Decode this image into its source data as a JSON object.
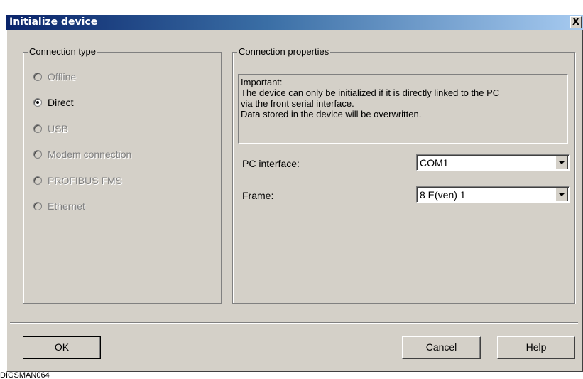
{
  "window": {
    "title": "Initialize device",
    "close_glyph": "X"
  },
  "connection_type": {
    "legend": "Connection type",
    "options": [
      {
        "label": "Offline",
        "enabled": false,
        "selected": false
      },
      {
        "label": "Direct",
        "enabled": true,
        "selected": true
      },
      {
        "label": "USB",
        "enabled": false,
        "selected": false
      },
      {
        "label": "Modem connection",
        "enabled": false,
        "selected": false
      },
      {
        "label": "PROFIBUS FMS",
        "enabled": false,
        "selected": false
      },
      {
        "label": "Ethernet",
        "enabled": false,
        "selected": false
      }
    ]
  },
  "connection_properties": {
    "legend": "Connection properties",
    "info_lines": [
      "Important:",
      "The device can only be initialized if it is directly linked to the PC",
      "via the front serial interface.",
      "Data stored in the device will be overwritten."
    ],
    "pc_interface": {
      "label": "PC interface:",
      "value": "COM1"
    },
    "frame": {
      "label": "Frame:",
      "value": "8 E(ven) 1"
    }
  },
  "buttons": {
    "ok": "OK",
    "cancel": "Cancel",
    "help": "Help"
  },
  "caption": "DIGSMAN064",
  "icons": {
    "close": "close-icon",
    "dropdown": "chevron-down-icon",
    "radio": "radio-button-icon"
  }
}
